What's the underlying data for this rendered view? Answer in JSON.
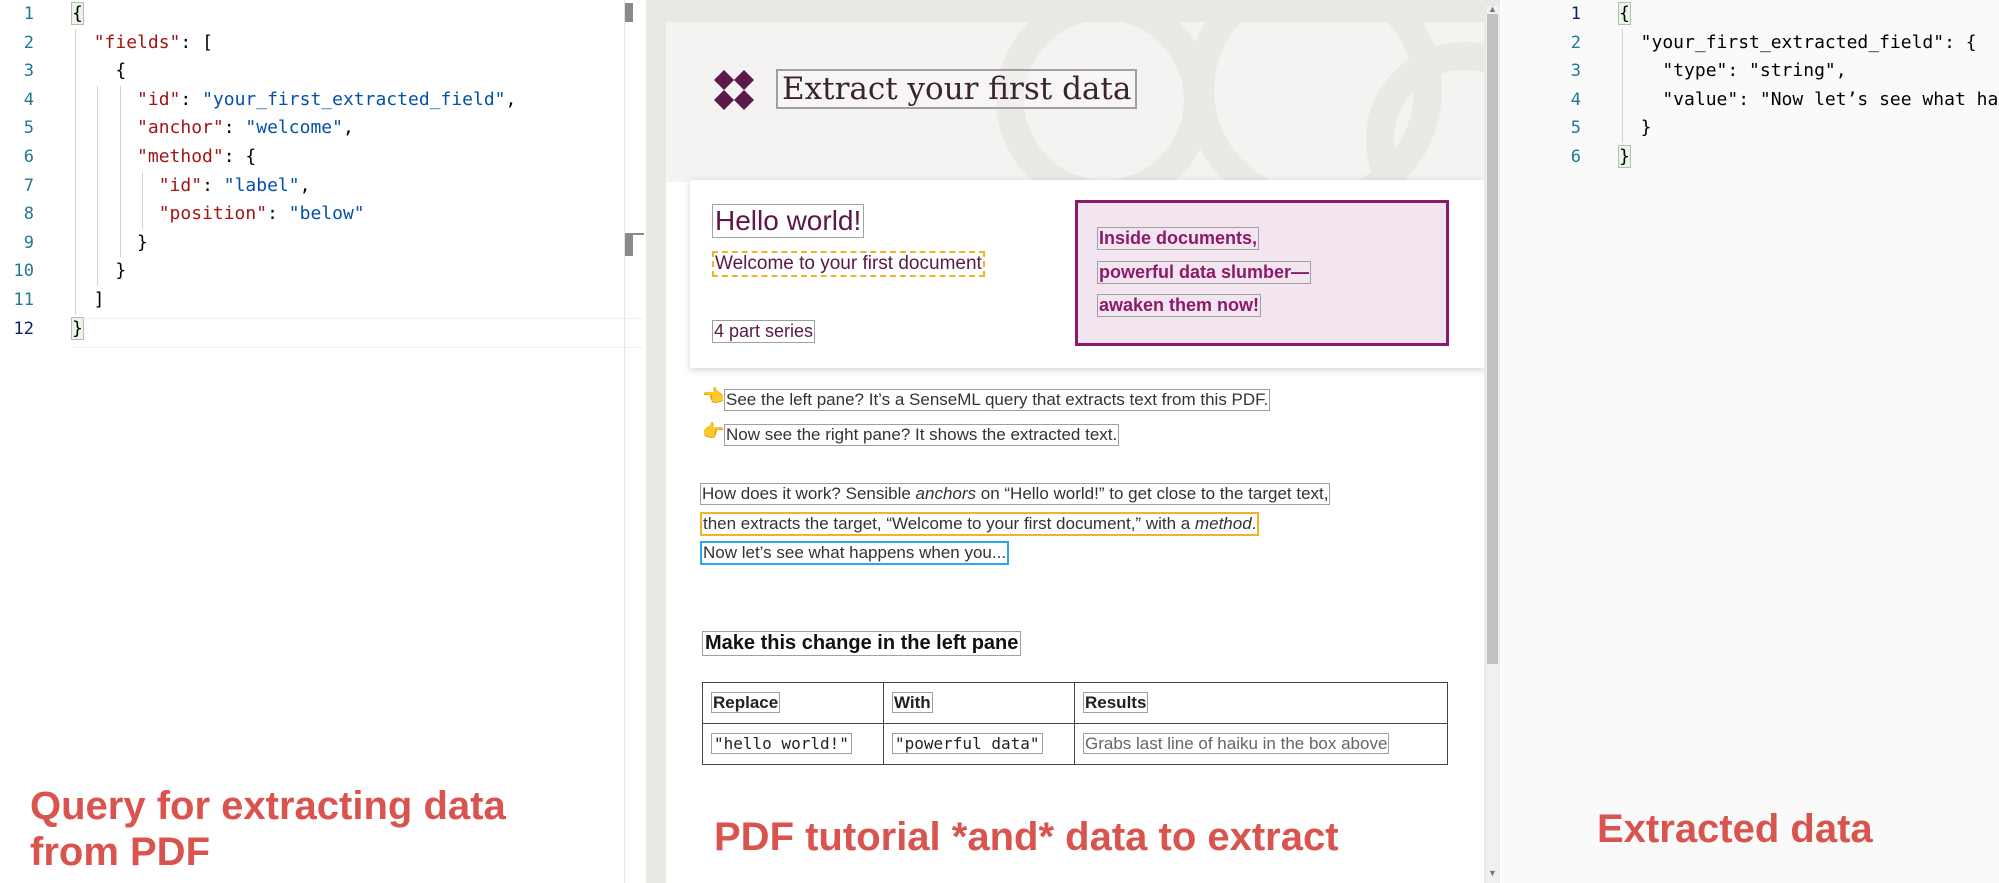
{
  "left_editor": {
    "lines": [
      {
        "n": "1",
        "parts": [
          {
            "t": "{",
            "c": "pun"
          }
        ]
      },
      {
        "n": "2",
        "parts": [
          {
            "t": "  ",
            "c": "pun"
          },
          {
            "t": "\"fields\"",
            "c": "key"
          },
          {
            "t": ": [",
            "c": "pun"
          }
        ]
      },
      {
        "n": "3",
        "parts": [
          {
            "t": "    {",
            "c": "pun"
          }
        ]
      },
      {
        "n": "4",
        "parts": [
          {
            "t": "      ",
            "c": "pun"
          },
          {
            "t": "\"id\"",
            "c": "key"
          },
          {
            "t": ": ",
            "c": "pun"
          },
          {
            "t": "\"your_first_extracted_field\"",
            "c": "str"
          },
          {
            "t": ",",
            "c": "pun"
          }
        ]
      },
      {
        "n": "5",
        "parts": [
          {
            "t": "      ",
            "c": "pun"
          },
          {
            "t": "\"anchor\"",
            "c": "key"
          },
          {
            "t": ": ",
            "c": "pun"
          },
          {
            "t": "\"welcome\"",
            "c": "str"
          },
          {
            "t": ",",
            "c": "pun"
          }
        ]
      },
      {
        "n": "6",
        "parts": [
          {
            "t": "      ",
            "c": "pun"
          },
          {
            "t": "\"method\"",
            "c": "key"
          },
          {
            "t": ": {",
            "c": "pun"
          }
        ]
      },
      {
        "n": "7",
        "parts": [
          {
            "t": "        ",
            "c": "pun"
          },
          {
            "t": "\"id\"",
            "c": "key"
          },
          {
            "t": ": ",
            "c": "pun"
          },
          {
            "t": "\"label\"",
            "c": "str"
          },
          {
            "t": ",",
            "c": "pun"
          }
        ]
      },
      {
        "n": "8",
        "parts": [
          {
            "t": "        ",
            "c": "pun"
          },
          {
            "t": "\"position\"",
            "c": "key"
          },
          {
            "t": ": ",
            "c": "pun"
          },
          {
            "t": "\"below\"",
            "c": "str"
          }
        ]
      },
      {
        "n": "9",
        "parts": [
          {
            "t": "      }",
            "c": "pun"
          }
        ]
      },
      {
        "n": "10",
        "parts": [
          {
            "t": "    }",
            "c": "pun"
          }
        ]
      },
      {
        "n": "11",
        "parts": [
          {
            "t": "  ]",
            "c": "pun"
          }
        ]
      },
      {
        "n": "12",
        "parts": [
          {
            "t": "}",
            "c": "pun"
          }
        ]
      }
    ]
  },
  "pdf": {
    "title": "Extract your first data",
    "hello": "Hello world!",
    "welcome": "Welcome to your first document",
    "series": "4 part series",
    "haiku": [
      "Inside documents,",
      "powerful data slumber—",
      "awaken them now!"
    ],
    "tip1": "See the left pane? It’s a SenseML query that extracts text from this PDF.",
    "tip2": "Now see the right pane? It shows the extracted text.",
    "para1_a": "How does it work? Sensible ",
    "para1_em": "anchors",
    "para1_b": " on “Hello world!” to get close to the target text,",
    "para2_a": "then extracts the target, “Welcome to your first document,” with a ",
    "para2_em": "method",
    "para2_b": ".",
    "para3": "Now let’s see what happens when you...",
    "heading": "Make this change in the left pane",
    "table": {
      "headers": [
        "Replace",
        "With",
        "Results"
      ],
      "row": [
        "\"hello world!\"",
        "\"powerful data\"",
        "Grabs last line of haiku in the box above"
      ]
    },
    "hand1": "👈",
    "hand2": "👉"
  },
  "right_editor": {
    "lines": [
      {
        "n": "1",
        "parts": [
          {
            "t": "{",
            "c": "pun"
          }
        ]
      },
      {
        "n": "2",
        "parts": [
          {
            "t": "  \"your_first_extracted_field\": {",
            "c": "pun"
          }
        ]
      },
      {
        "n": "3",
        "parts": [
          {
            "t": "    \"type\": \"string\",",
            "c": "pun"
          }
        ]
      },
      {
        "n": "4",
        "parts": [
          {
            "t": "    \"value\": \"Now let’s see what happens when you...\"",
            "c": "pun"
          }
        ]
      },
      {
        "n": "5",
        "parts": [
          {
            "t": "  }",
            "c": "pun"
          }
        ]
      },
      {
        "n": "6",
        "parts": [
          {
            "t": "}",
            "c": "pun"
          }
        ]
      }
    ]
  },
  "captions": {
    "left_line1": "Query for extracting data",
    "left_line2": "from PDF",
    "middle": "PDF tutorial *and* data to extract",
    "right": "Extracted data"
  },
  "colors": {
    "caption": "#d9534f",
    "brand": "#5b1848",
    "haiku_border": "#8b1a6a"
  }
}
